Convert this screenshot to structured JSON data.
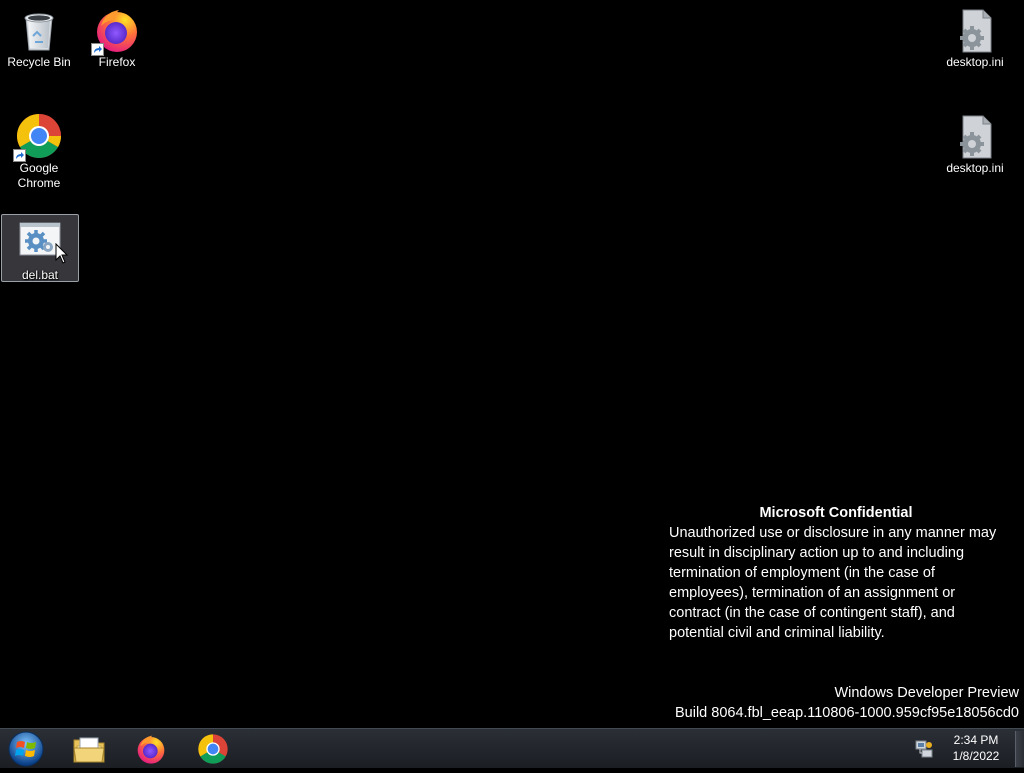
{
  "desktop": {
    "icons": [
      {
        "label": "Recycle Bin",
        "icon": "recycle-bin-icon"
      },
      {
        "label": "Firefox",
        "icon": "firefox-icon",
        "shortcut": true
      },
      {
        "label": "desktop.ini",
        "icon": "settings-file-icon"
      },
      {
        "label": "Google Chrome",
        "icon": "chrome-icon",
        "shortcut": true
      },
      {
        "label": "desktop.ini",
        "icon": "settings-file-icon"
      },
      {
        "label": "del.bat",
        "icon": "batch-file-icon",
        "selected": true
      }
    ]
  },
  "watermark": {
    "title": "Microsoft Confidential",
    "body": "Unauthorized use or disclosure in any manner may result in disciplinary action up to and including termination of employment (in the case of employees), termination of an assignment or contract (in the case of contingent staff), and potential civil and criminal liability.",
    "edition": "Windows Developer Preview",
    "build": "Build 8064.fbl_eeap.110806-1000.959cf95e18056cd0"
  },
  "taskbar": {
    "start": "start-orb-icon",
    "pinned": [
      "file-explorer-icon",
      "firefox-icon",
      "chrome-icon"
    ],
    "clock": {
      "time": "2:34 PM",
      "date": "1/8/2022"
    },
    "tray": [
      "network-icon"
    ]
  },
  "colors": {
    "desktop_bg": "#000000",
    "taskbar_bg": "#1f2228",
    "selection": "#5c6068"
  }
}
